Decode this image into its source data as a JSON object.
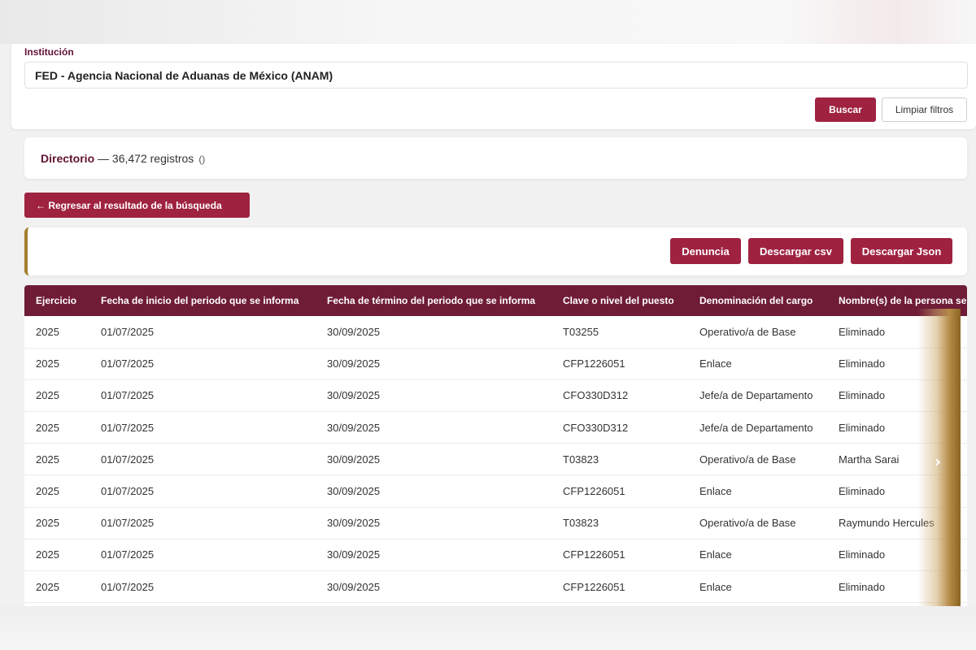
{
  "filters": {
    "institution_label": "Institución",
    "institution_value": "FED - Agencia Nacional de Aduanas de México (ANAM)",
    "search_label": "Buscar",
    "clear_label": "Limpiar filtros"
  },
  "directory": {
    "title": "Directorio",
    "separator": " — ",
    "count_text": "36,472 registros",
    "paren": "()"
  },
  "back_button": "← Regresar al resultado de la búsqueda",
  "actions": {
    "denuncia": "Denuncia",
    "csv": "Descargar csv",
    "json": "Descargar Json"
  },
  "table": {
    "headers": [
      "Ejercicio",
      "Fecha de inicio del periodo que se informa",
      "Fecha de término del periodo que se informa",
      "Clave o nivel del puesto",
      "Denominación del cargo",
      "Nombre(s) de la persona se"
    ],
    "rows": [
      [
        "2025",
        "01/07/2025",
        "30/09/2025",
        "T03255",
        "Operativo/a de Base",
        "Eliminado"
      ],
      [
        "2025",
        "01/07/2025",
        "30/09/2025",
        "CFP1226051",
        "Enlace",
        "Eliminado"
      ],
      [
        "2025",
        "01/07/2025",
        "30/09/2025",
        "CFO330D312",
        "Jefe/a de Departamento",
        "Eliminado"
      ],
      [
        "2025",
        "01/07/2025",
        "30/09/2025",
        "CFO330D312",
        "Jefe/a de Departamento",
        "Eliminado"
      ],
      [
        "2025",
        "01/07/2025",
        "30/09/2025",
        "T03823",
        "Operativo/a de Base",
        "Martha Sarai"
      ],
      [
        "2025",
        "01/07/2025",
        "30/09/2025",
        "CFP1226051",
        "Enlace",
        "Eliminado"
      ],
      [
        "2025",
        "01/07/2025",
        "30/09/2025",
        "T03823",
        "Operativo/a de Base",
        "Raymundo Hercules"
      ],
      [
        "2025",
        "01/07/2025",
        "30/09/2025",
        "CFP1226051",
        "Enlace",
        "Eliminado"
      ],
      [
        "2025",
        "01/07/2025",
        "30/09/2025",
        "CFP1226051",
        "Enlace",
        "Eliminado"
      ]
    ]
  },
  "scroll_icon": "chevron-right-icon",
  "colors": {
    "brand": "#9f2241",
    "header_bg": "#6f1c36",
    "title_text": "#611232",
    "accent_gold": "#a57f2c"
  }
}
